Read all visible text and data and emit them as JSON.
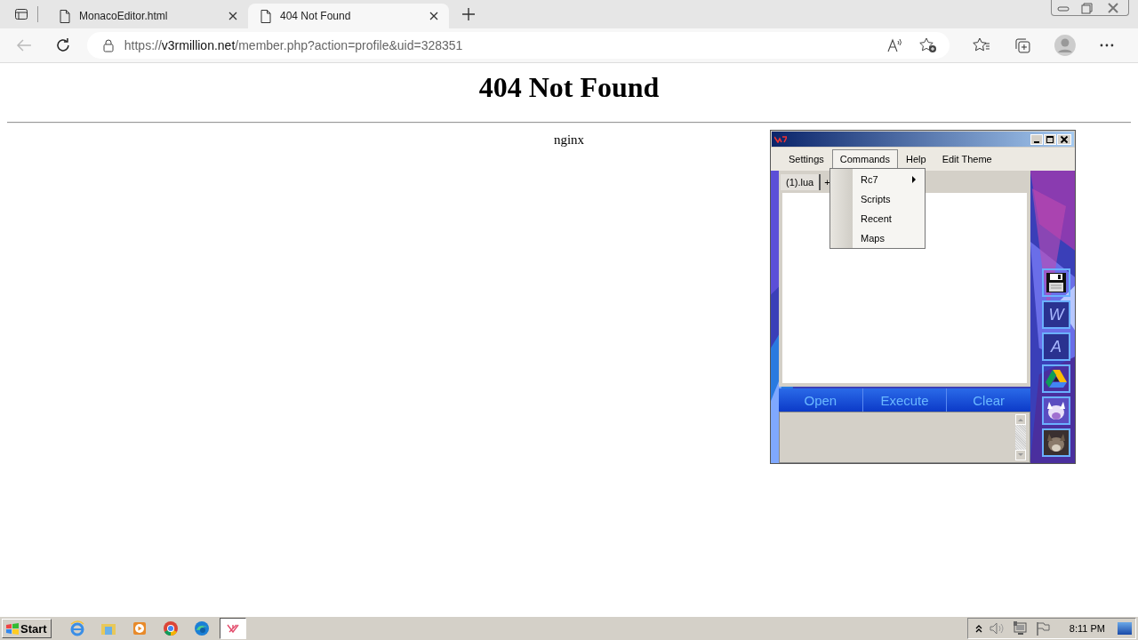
{
  "browser": {
    "tabs": [
      {
        "title": "MonacoEditor.html",
        "selected": false
      },
      {
        "title": "404 Not Found",
        "selected": true
      }
    ],
    "address": {
      "scheme": "https://",
      "host": "v3rmillion.net",
      "path": "/member.php?action=profile&uid=328351"
    }
  },
  "page": {
    "heading": "404 Not Found",
    "server": "nginx"
  },
  "rc7": {
    "menu": [
      {
        "label": "Settings",
        "open": false
      },
      {
        "label": "Commands",
        "open": true
      },
      {
        "label": "Help",
        "open": false
      },
      {
        "label": "Edit Theme",
        "open": false
      }
    ],
    "dropdown": [
      {
        "label": "Rc7",
        "submenu": true
      },
      {
        "label": "Scripts",
        "submenu": false
      },
      {
        "label": "Recent",
        "submenu": false
      },
      {
        "label": "Maps",
        "submenu": false
      }
    ],
    "tabs": [
      {
        "label": "(1).lua",
        "selected": true
      }
    ],
    "add_tab": "+",
    "buttons": [
      "Open",
      "Execute",
      "Clear"
    ],
    "side_buttons": [
      {
        "kind": "save"
      },
      {
        "kind": "letter",
        "label": "W"
      },
      {
        "kind": "letter",
        "label": "A"
      },
      {
        "kind": "drive"
      },
      {
        "kind": "picture"
      },
      {
        "kind": "picture"
      }
    ]
  },
  "taskbar": {
    "start": "Start",
    "apps": [
      {
        "kind": "ie",
        "selected": false
      },
      {
        "kind": "folder",
        "selected": false
      },
      {
        "kind": "media",
        "selected": false
      },
      {
        "kind": "chrome",
        "selected": false
      },
      {
        "kind": "edge",
        "selected": false
      },
      {
        "kind": "rc7",
        "selected": true
      }
    ],
    "clock": "8:11 PM"
  }
}
